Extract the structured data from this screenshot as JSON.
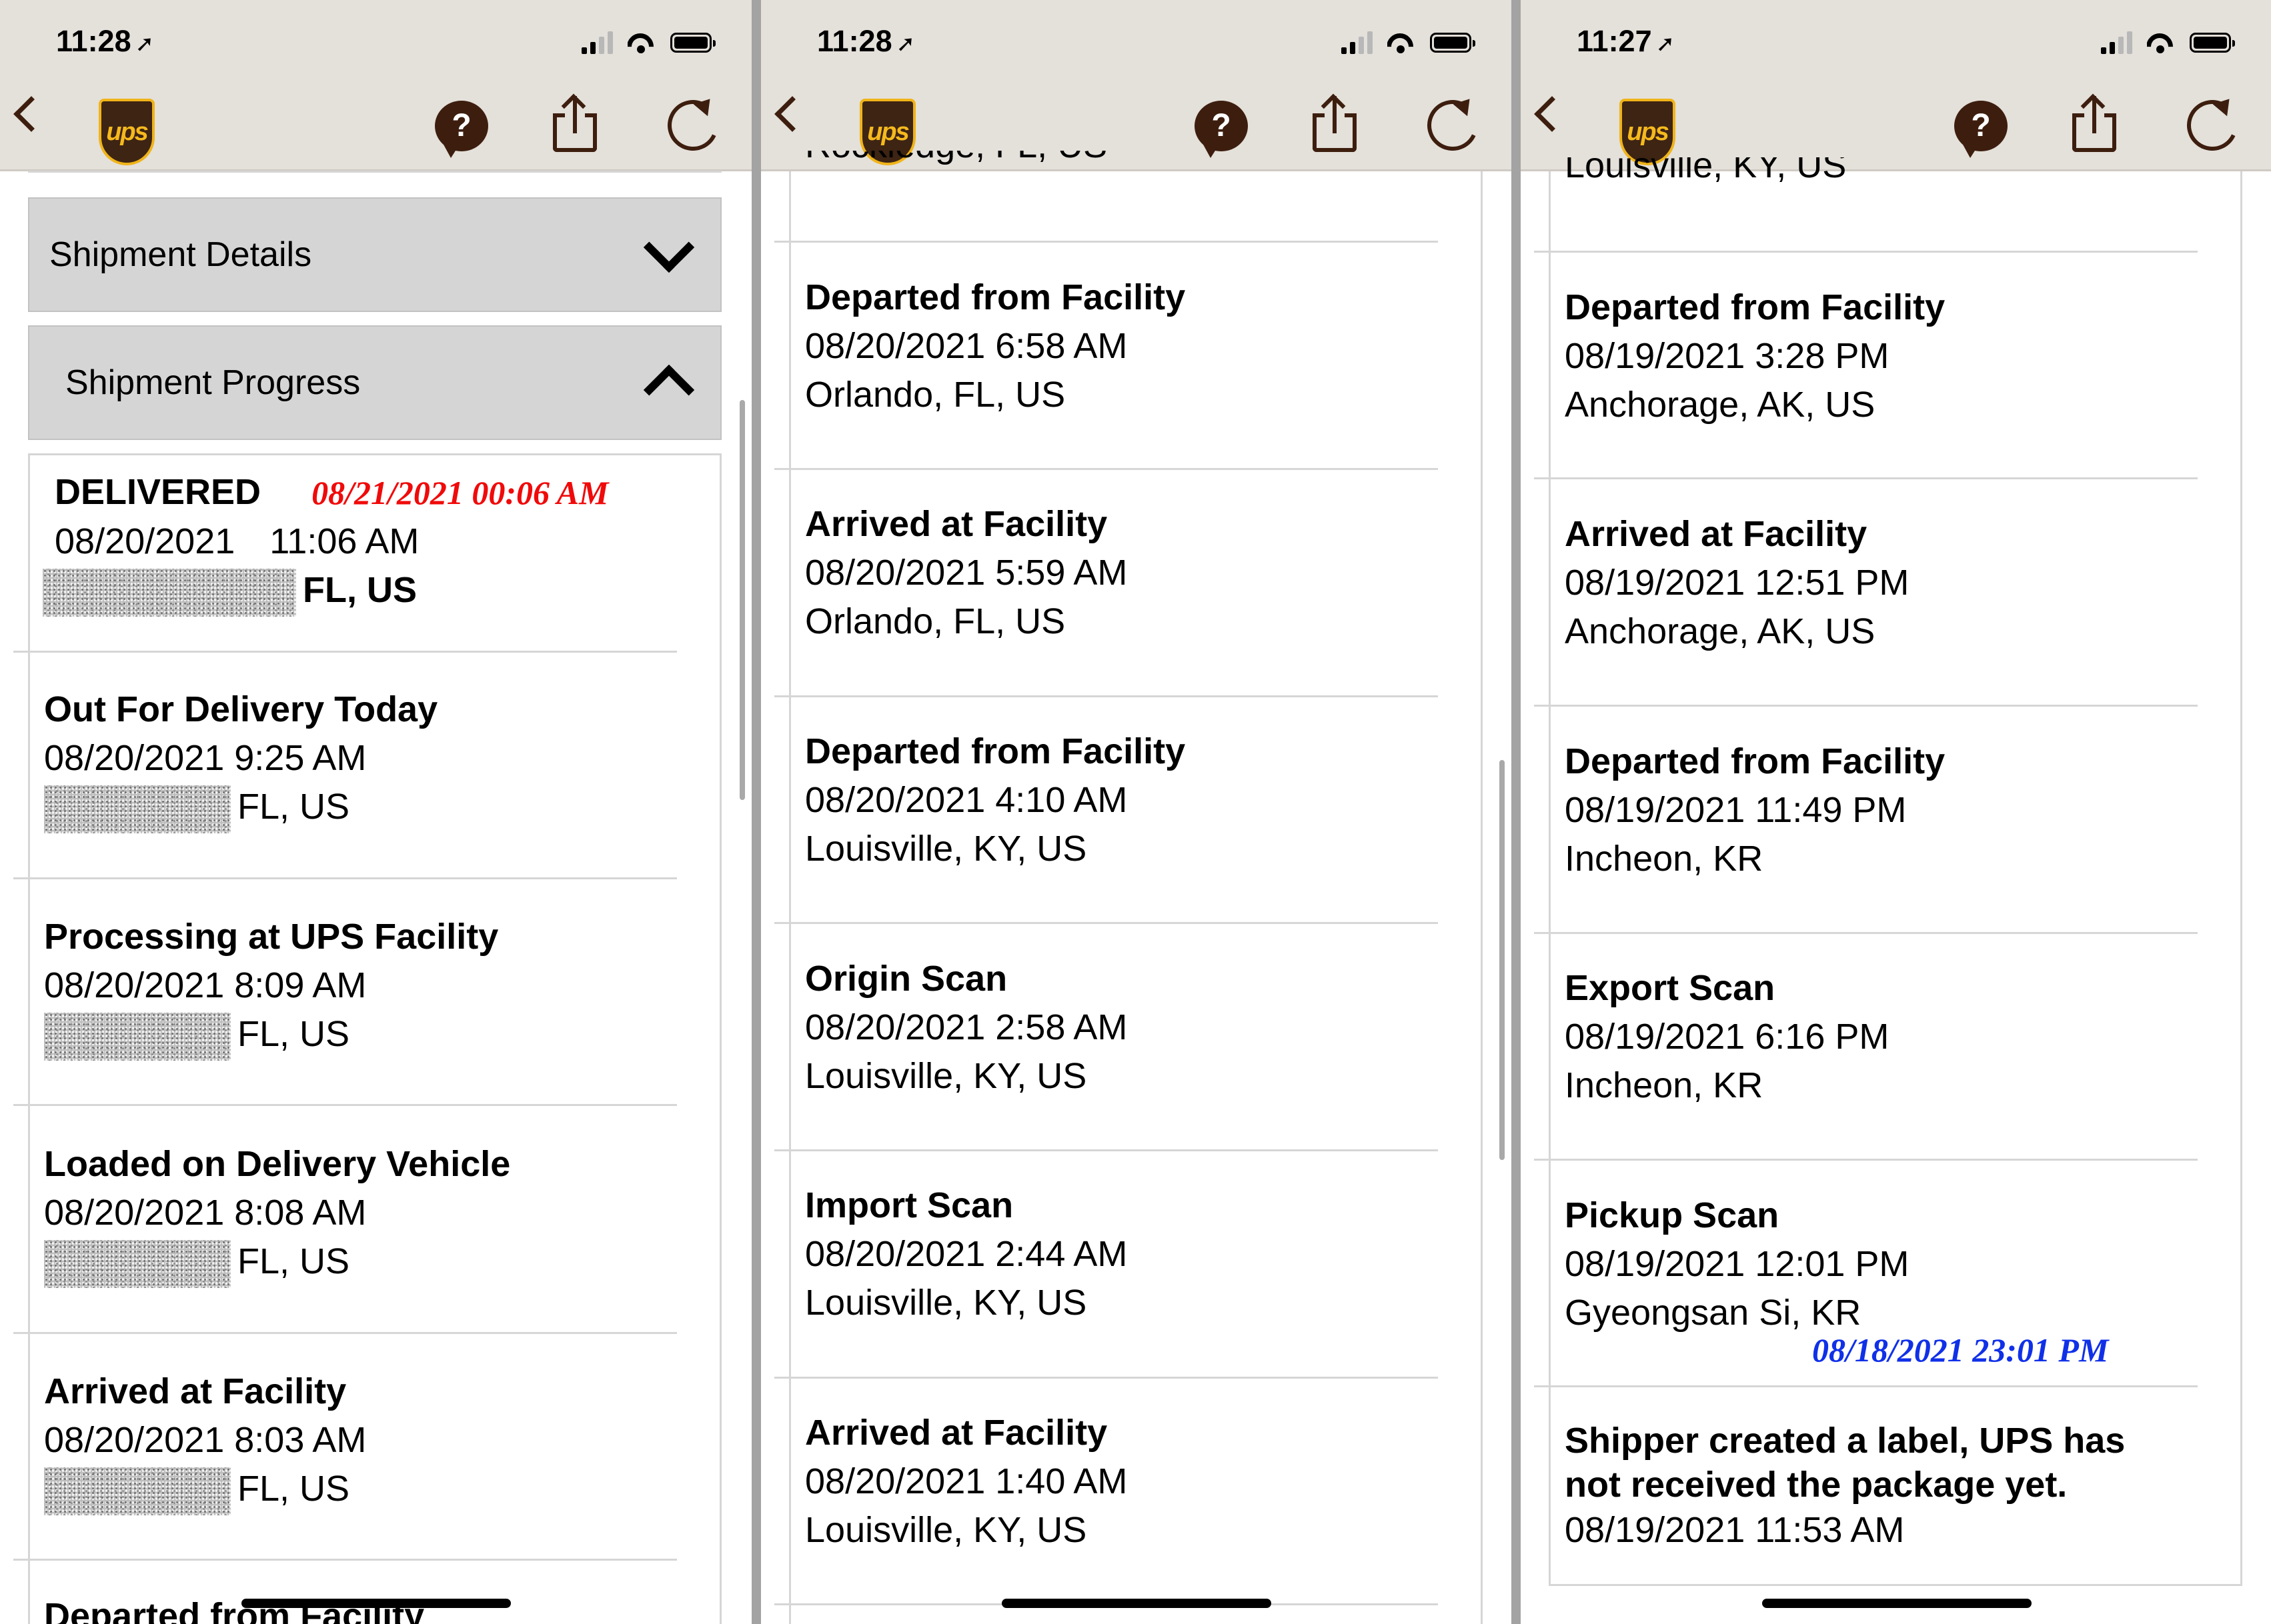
{
  "status_bar": {
    "phone1_time": "11:28",
    "phone2_time": "11:28",
    "phone3_time": "11:27",
    "loc_glyph": "➚"
  },
  "nav": {
    "logo_text": "ups",
    "help_glyph": "?"
  },
  "accordion": {
    "details_label": "Shipment Details",
    "progress_label": "Shipment Progress"
  },
  "phone1": {
    "delivered": {
      "status": "DELIVERED",
      "annotation": "08/21/2021  00:06 AM",
      "date": "08/20/2021",
      "time": "11:06 AM",
      "location": "FL, US"
    },
    "events": [
      {
        "title": "Out For Delivery Today",
        "datetime": "08/20/2021 9:25 AM",
        "location": "FL, US"
      },
      {
        "title": "Processing at UPS Facility",
        "datetime": "08/20/2021 8:09 AM",
        "location": "FL, US"
      },
      {
        "title": "Loaded on Delivery Vehicle",
        "datetime": "08/20/2021 8:08 AM",
        "location": "FL, US"
      },
      {
        "title": "Arrived at Facility",
        "datetime": "08/20/2021 8:03 AM",
        "location": "FL, US"
      }
    ],
    "cut_bottom_title": "Departed from Facility"
  },
  "phone2": {
    "cut_top_location": "Rockledge, FL, US",
    "events": [
      {
        "title": "Departed from Facility",
        "datetime": "08/20/2021 6:58 AM",
        "location": "Orlando, FL, US"
      },
      {
        "title": "Arrived at Facility",
        "datetime": "08/20/2021 5:59 AM",
        "location": "Orlando, FL, US"
      },
      {
        "title": "Departed from Facility",
        "datetime": "08/20/2021 4:10 AM",
        "location": "Louisville, KY, US"
      },
      {
        "title": "Origin Scan",
        "datetime": "08/20/2021 2:58 AM",
        "location": "Louisville, KY, US"
      },
      {
        "title": "Import Scan",
        "datetime": "08/20/2021 2:44 AM",
        "location": "Louisville, KY, US"
      },
      {
        "title": "Arrived at Facility",
        "datetime": "08/20/2021 1:40 AM",
        "location": "Louisville, KY, US"
      }
    ]
  },
  "phone3": {
    "cut_top_location": "Louisville, KY, US",
    "events": [
      {
        "title": "Departed from Facility",
        "datetime": "08/19/2021 3:28 PM",
        "location": "Anchorage, AK, US"
      },
      {
        "title": "Arrived at Facility",
        "datetime": "08/19/2021 12:51 PM",
        "location": "Anchorage, AK, US"
      },
      {
        "title": "Departed from Facility",
        "datetime": "08/19/2021 11:49 PM",
        "location": "Incheon, KR"
      },
      {
        "title": "Export Scan",
        "datetime": "08/19/2021 6:16 PM",
        "location": "Incheon, KR"
      },
      {
        "title": "Pickup Scan",
        "datetime": "08/19/2021 12:01 PM",
        "location": "Gyeongsan Si, KR"
      }
    ],
    "pickup_annotation": "08/18/2021 23:01 PM",
    "label_created": {
      "title": "Shipper created a label, UPS has not received the package yet.",
      "datetime": "08/19/2021 11:53 AM"
    }
  },
  "colors": {
    "brand_brown": "#3d1e0e",
    "brand_gold": "#f0b419",
    "annotation_red": "#f00a0a",
    "annotation_blue": "#1030e8"
  }
}
